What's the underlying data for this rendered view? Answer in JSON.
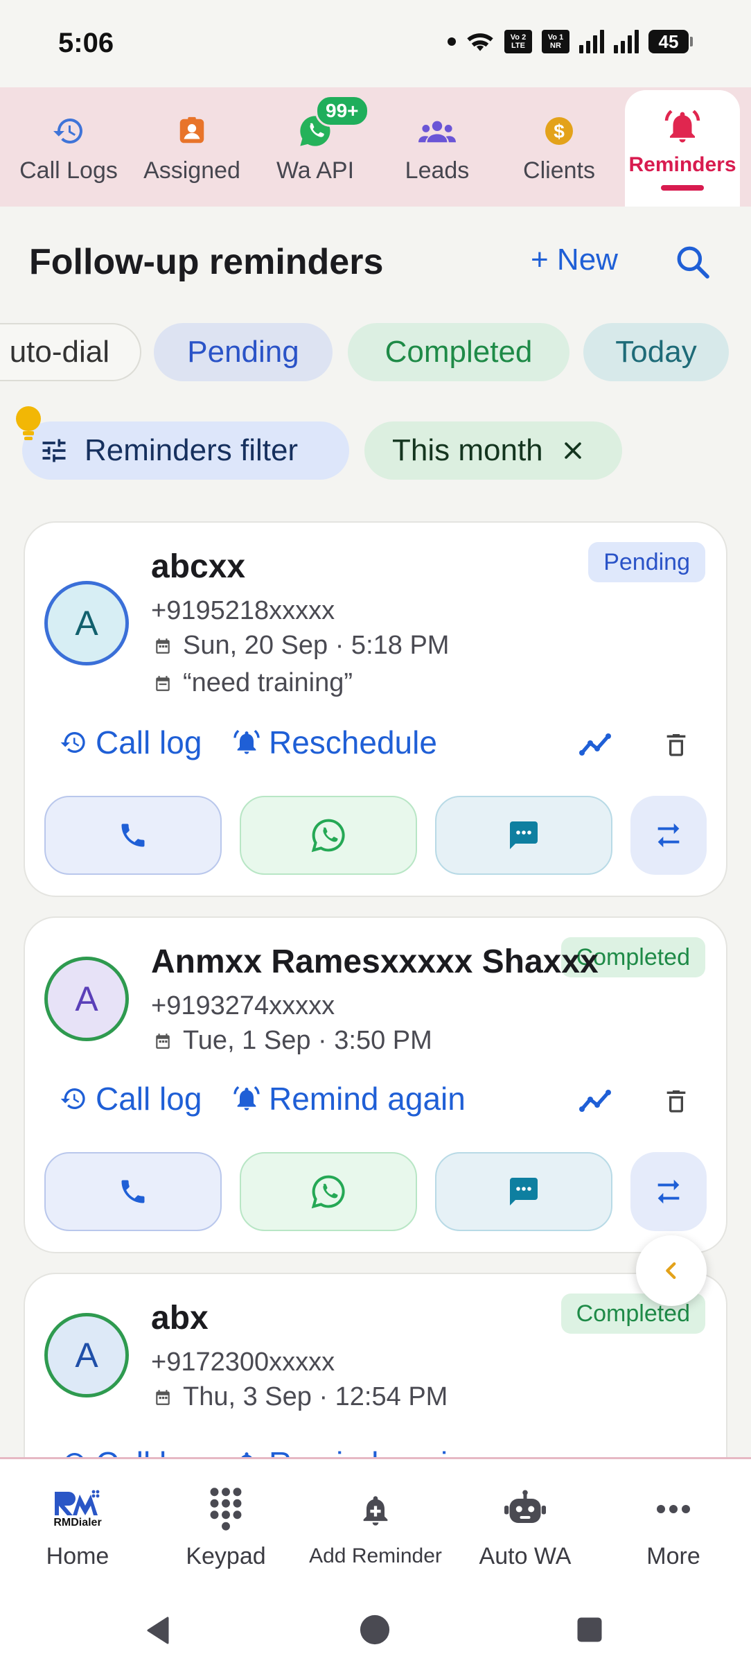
{
  "status_bar": {
    "time": "5:06",
    "battery": "45",
    "volte1_top": "Vo 2",
    "volte1_bottom": "LTE",
    "volte2_top": "Vo 1",
    "volte2_bottom": "NR"
  },
  "tabs": [
    {
      "label": "Call Logs",
      "icon": "history-icon"
    },
    {
      "label": "Assigned",
      "icon": "assigned-icon"
    },
    {
      "label": "Wa API",
      "icon": "whatsapp-icon",
      "badge": "99+"
    },
    {
      "label": "Leads",
      "icon": "group-icon"
    },
    {
      "label": "Clients",
      "icon": "dollar-icon"
    },
    {
      "label": "Reminders",
      "icon": "alarm-bell-icon",
      "active": true
    }
  ],
  "header": {
    "title": "Follow-up reminders",
    "new_label": "+ New"
  },
  "chips": {
    "auto_dial": "uto-dial",
    "pending": "Pending",
    "completed": "Completed",
    "today": "Today"
  },
  "filters": {
    "reminders_filter": "Reminders filter",
    "this_month": "This month"
  },
  "reminders": [
    {
      "initial": "A",
      "name": "abcxx",
      "phone": "+9195218xxxxx",
      "datetime": "Sun, 20 Sep · 5:18 PM",
      "note": "“need training”",
      "status": "Pending",
      "call_log_label": "Call log",
      "second_action_label": "Reschedule"
    },
    {
      "initial": "A",
      "name": "Anmxx Ramesxxxxx Shaxxx",
      "phone": "+9193274xxxxx",
      "datetime": "Tue, 1 Sep · 3:50 PM",
      "status": "Completed",
      "call_log_label": "Call log",
      "second_action_label": "Remind again"
    },
    {
      "initial": "A",
      "name": "abx",
      "phone": "+9172300xxxxx",
      "datetime": "Thu, 3 Sep · 12:54 PM",
      "status": "Completed",
      "call_log_label": "Call log",
      "second_action_label": "Remind again"
    }
  ],
  "bottom_nav": [
    {
      "label": "Home",
      "icon": "rmdialer-logo",
      "logo_text": "RMDialer"
    },
    {
      "label": "Keypad",
      "icon": "keypad-icon"
    },
    {
      "label": "Add Reminder",
      "icon": "add-alarm-icon"
    },
    {
      "label": "Auto WA",
      "icon": "robot-icon"
    },
    {
      "label": "More",
      "icon": "more-icon"
    }
  ],
  "colors": {
    "accent": "#1f5fd6",
    "active_tab": "#d81b4f",
    "tabbar_bg": "#f3dfe2",
    "pending": "#2a53c7",
    "completed": "#1e8a47"
  }
}
